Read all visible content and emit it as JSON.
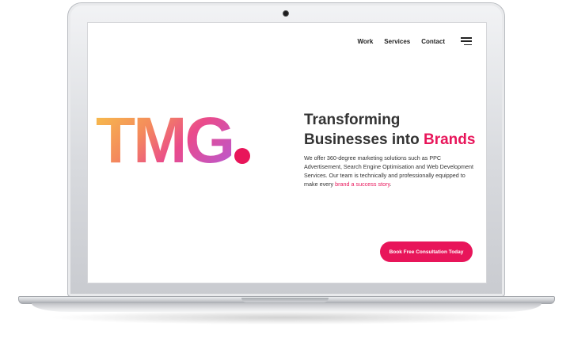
{
  "nav": {
    "items": [
      "Work",
      "Services",
      "Contact"
    ],
    "menu_icon": "hamburger-menu-icon"
  },
  "hero": {
    "logo": "TMG",
    "headline_line1": "Transforming",
    "headline_line2_prefix": "Businesses into ",
    "headline_line2_accent": "Brands",
    "description": "We offer 360-degree marketing solutions such as PPC Advertisement, Search Engine Optimisation and Web Development Services. Our team is technically and professionally equipped to make every ",
    "description_link": "brand a success story",
    "description_end": ".",
    "cta_label": "Book Free Consultation Today"
  },
  "colors": {
    "accent": "#e8155a",
    "text": "#333333",
    "logo_gradient": [
      "#f7c04a",
      "#f48a5c",
      "#ea4b8b",
      "#b45ad8"
    ]
  }
}
